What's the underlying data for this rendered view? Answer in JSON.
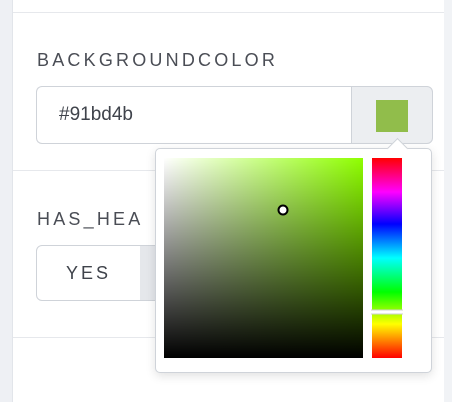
{
  "background_color": {
    "label": "BACKGROUNDCOLOR",
    "value": "#91bd4b",
    "swatch_color": "#91bd4b"
  },
  "has_header": {
    "label": "HAS_HEA",
    "yes_label": "YES"
  },
  "color_picker": {
    "hue_color": "#8fff00",
    "saturation": 0.6,
    "brightness": 0.74,
    "hue_position": 0.77
  }
}
